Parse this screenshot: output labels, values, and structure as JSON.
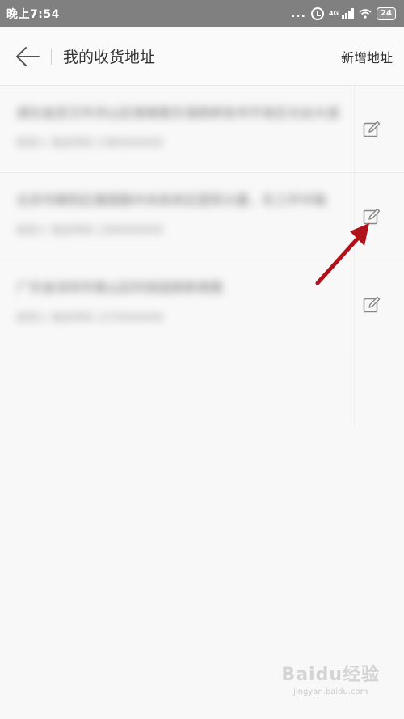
{
  "status_bar": {
    "time": "晚上7:54",
    "more": "...",
    "network": "4G",
    "battery": "24"
  },
  "header": {
    "title": "我的收货地址",
    "add_label": "新增地址"
  },
  "addresses": [
    {
      "line1": "湖北省武汉市洪山区珞喻路东湖高新技术开发区光谷大道",
      "line2": "收货人  电话号码  1380000000"
    },
    {
      "line1": "北京市朝阳区建国路中央商务区国贸大厦，东三环中路",
      "line2": "收货人  电话号码  1390000000"
    },
    {
      "line1": "广东省深圳市南山区科技园高新南路",
      "line2": "收货人  电话号码  1370000000"
    }
  ],
  "colors": {
    "status_bar": "#808080",
    "arrow": "#b0121b",
    "icon": "#888888"
  },
  "watermark": {
    "logo": "Baidu经验",
    "url": "jingyan.baidu.com"
  }
}
